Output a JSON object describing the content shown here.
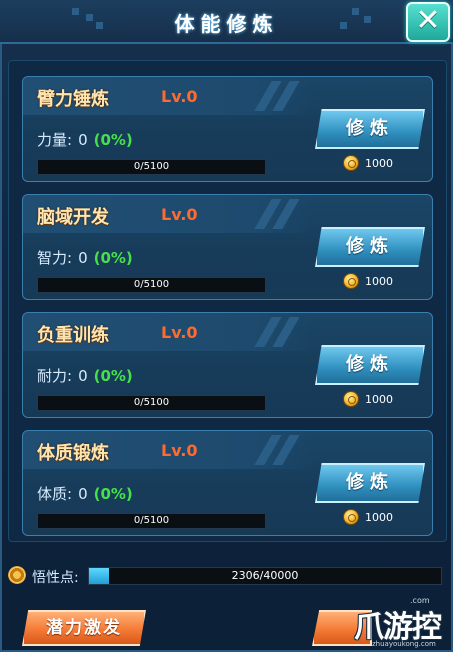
{
  "header": {
    "title": "体能修炼",
    "close_label": "✕"
  },
  "cards": [
    {
      "title": "臂力锤炼",
      "level": "Lv.0",
      "stat_label": "力量:",
      "stat_value": "0",
      "stat_pct": "(0%)",
      "progress_text": "0/5100",
      "progress": 0,
      "button_label": "修炼",
      "cost": "1000"
    },
    {
      "title": "脑域开发",
      "level": "Lv.0",
      "stat_label": "智力:",
      "stat_value": "0",
      "stat_pct": "(0%)",
      "progress_text": "0/5100",
      "progress": 0,
      "button_label": "修炼",
      "cost": "1000"
    },
    {
      "title": "负重训练",
      "level": "Lv.0",
      "stat_label": "耐力:",
      "stat_value": "0",
      "stat_pct": "(0%)",
      "progress_text": "0/5100",
      "progress": 0,
      "button_label": "修炼",
      "cost": "1000"
    },
    {
      "title": "体质锻炼",
      "level": "Lv.0",
      "stat_label": "体质:",
      "stat_value": "0",
      "stat_pct": "(0%)",
      "progress_text": "0/5100",
      "progress": 0,
      "button_label": "修炼",
      "cost": "1000"
    }
  ],
  "insight": {
    "label": "悟性点:",
    "progress_text": "2306/40000",
    "progress": 0.0577
  },
  "footer": {
    "burst_label": "潜力激发"
  },
  "watermark": {
    "logo": "爪游控",
    "dotcom": ".com",
    "url": "zhuayoukong.com"
  },
  "colors": {
    "accent": "#2fa3d6",
    "level": "#ff6a2e",
    "percent": "#45e04a",
    "title": "#ffe6b0"
  }
}
